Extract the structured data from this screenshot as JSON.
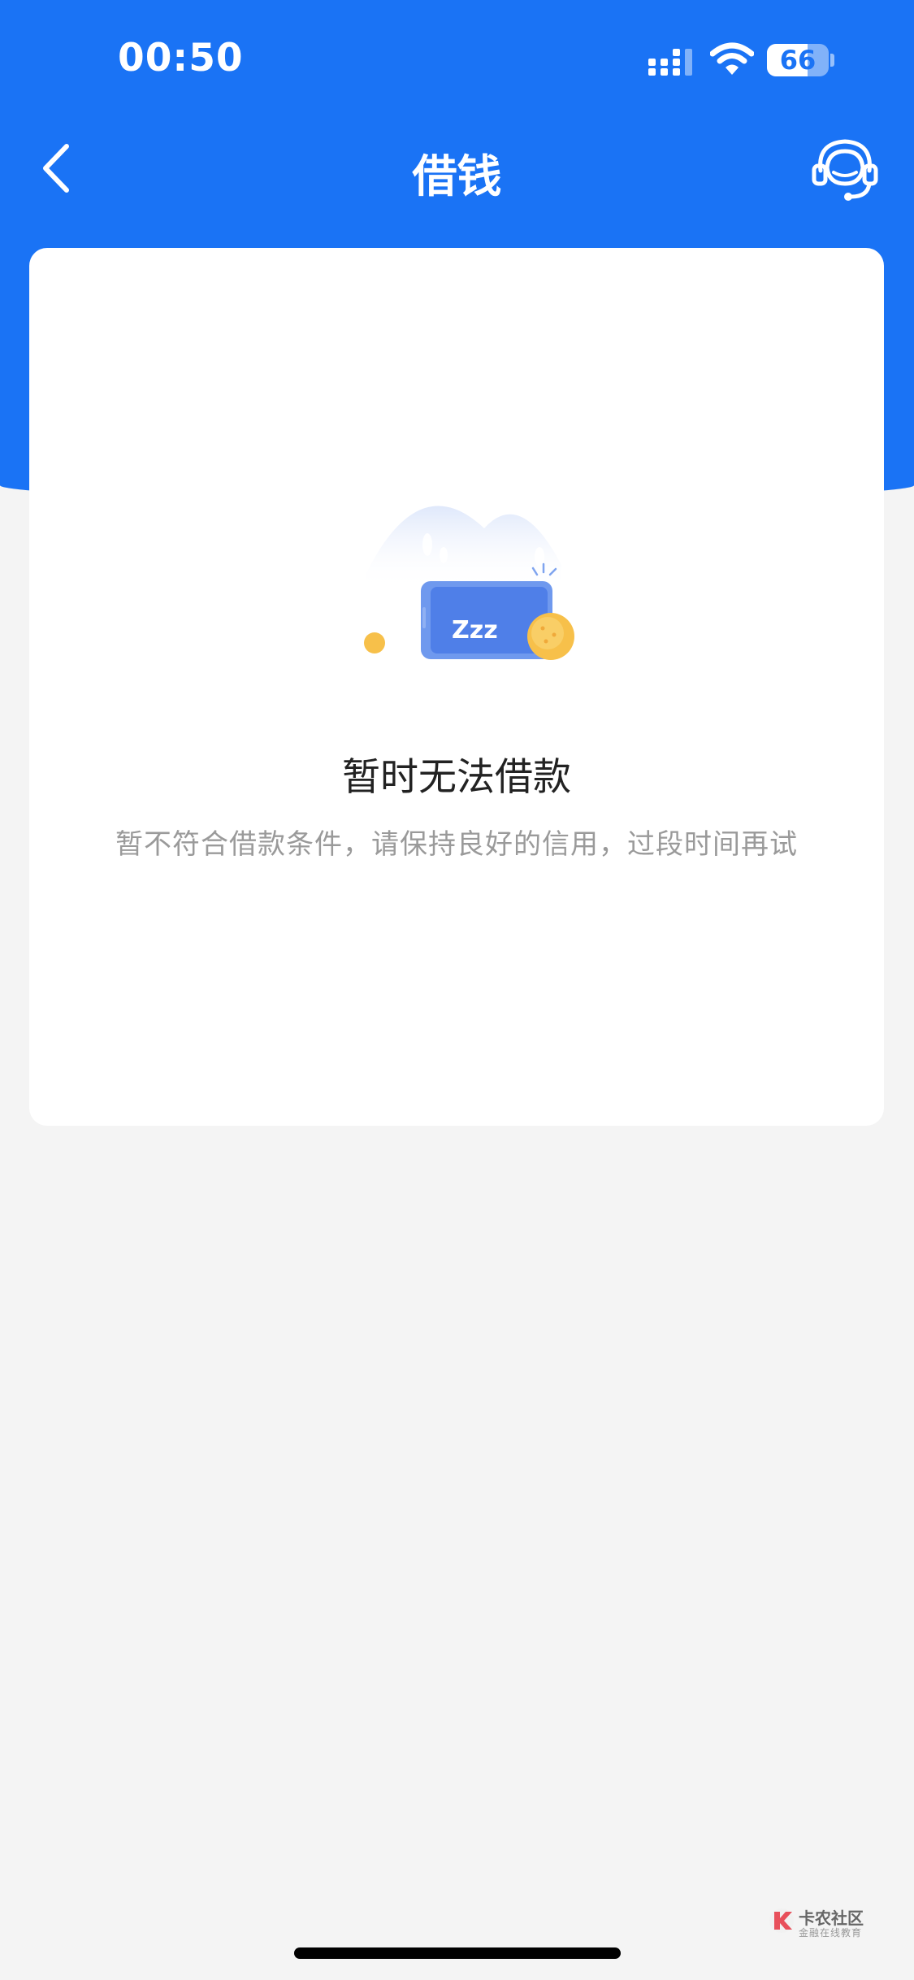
{
  "status_bar": {
    "time": "00:50",
    "battery_level": 66,
    "battery_label": "66",
    "signal_icon": "cellular-signal-icon",
    "wifi_icon": "wifi-icon"
  },
  "nav": {
    "title": "借钱",
    "back_icon": "chevron-left-icon",
    "service_icon": "customer-service-headset-icon"
  },
  "empty_state": {
    "illustration": "sleeping-phone-illustration",
    "illustration_text": "Zzz",
    "title": "暂时无法借款",
    "description": "暂不符合借款条件，请保持良好的信用，过段时间再试"
  },
  "watermark": {
    "title": "卡农社区",
    "subtitle": "金融在线教育"
  },
  "colors": {
    "brand_blue": "#1a73f5",
    "page_background": "#f4f4f4",
    "card_background": "#ffffff",
    "coin": "#f7c04a",
    "title_text": "#222222",
    "desc_text": "#9a9a9a"
  }
}
